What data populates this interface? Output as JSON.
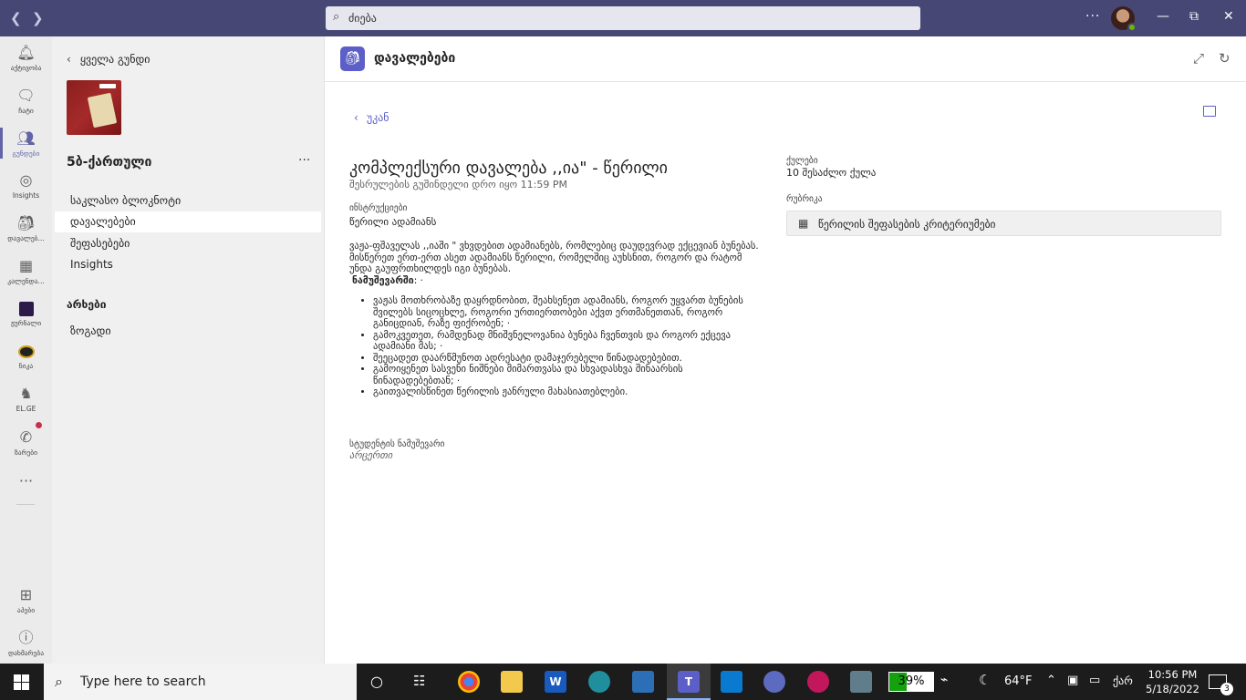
{
  "search": {
    "value": "ძიება"
  },
  "rail": {
    "items": [
      {
        "label": "აქტივობა",
        "icon": "bell-icon"
      },
      {
        "label": "ჩატი",
        "icon": "chat-icon"
      },
      {
        "label": "გუნდები",
        "icon": "teams-icon"
      },
      {
        "label": "Insights",
        "icon": "insights-icon"
      },
      {
        "label": "დავალებ...",
        "icon": "assignments-icon"
      },
      {
        "label": "კალენდა...",
        "icon": "calendar-icon"
      },
      {
        "label": "ჟურნალი",
        "icon": "journal-icon"
      },
      {
        "label": "ნიკა",
        "icon": "nika-icon"
      },
      {
        "label": "EL.GE",
        "icon": "elge-icon"
      },
      {
        "label": "ზარები",
        "icon": "calls-icon"
      }
    ],
    "apps_label": "აპები",
    "help_label": "დახმარება"
  },
  "team": {
    "back_label": "ყველა გუნდი",
    "name": "5ბ-ქართული",
    "channels": [
      "საკლასო ბლოკნოტი",
      "დავალებები",
      "შეფასებები",
      "Insights"
    ],
    "hidden_heading": "არხები",
    "hidden_channels": [
      "ზოგადი"
    ]
  },
  "main": {
    "app_title": "დავალებები",
    "back_label": "უკან",
    "assignment": {
      "title": "კომპლექსური დავალება ,,ია\" - წერილი",
      "due": "შესრულების გუშინდელი დრო იყო 11:59 PM",
      "instructions_label": "ინსტრუქციები",
      "instructions_title": "წერილი ადამიანს",
      "paragraph": "ვაჟა-ფშაველას ,,იაში \" ვხვდებით ადამიანებს, რომლებიც დაუდევრად ექცევიან ბუნებას. მისწერეთ ერთ-ერთ ასეთ ადამიანს წერილი, რომელშიც აუხსნით, როგორ და რატომ უნდა გაუფრთხილდეს იგი ბუნებას.",
      "sample_label": "ნამუშევარში",
      "sample_suffix": ": ·",
      "bullets": [
        "ვაჟას მოთხრობაზე დაყრდნობით, შეახსენეთ ადამიანს, როგორ უყვართ ბუნების შვილებს  სიცოცხლე, როგორი ურთიერთობები აქვთ ერთმანეთთან, როგორ განიცდიან, რაზე ფიქრობენ; ·",
        " გამოკვეთეთ, რამდენად მნიშვნელოვანია ბუნება ჩვენთვის და როგორ ექცევა ადამიანი მას; ·",
        "შეეცადეთ დაარწმუნოთ ადრესატი დამაჯერებელი წინადადებებით.",
        "გამოიყენეთ სასვენი ნიშნები მიმართვასა და სხვადასხვა შინაარსის წინადადებებთან; ·",
        "გაითვალისწინეთ წერილის ჟანრული მახასიათებლები."
      ],
      "student_work_label": "სტუდენტის ნამუშევარი",
      "student_work_value": "არცერთი",
      "points_label": "ქულები",
      "points_value": "10 შესაძლო ქულა",
      "rubric_label": "რუბრიკა",
      "rubric_value": "წერილის შეფასების კრიტერიუმები"
    }
  },
  "taskbar": {
    "search_placeholder": "Type here to search",
    "battery_percent": "39%",
    "battery_fraction": 0.39,
    "weather": "64°F",
    "lang": "ქარ",
    "time": "10:56 PM",
    "date": "5/18/2022",
    "notifications": "3"
  }
}
